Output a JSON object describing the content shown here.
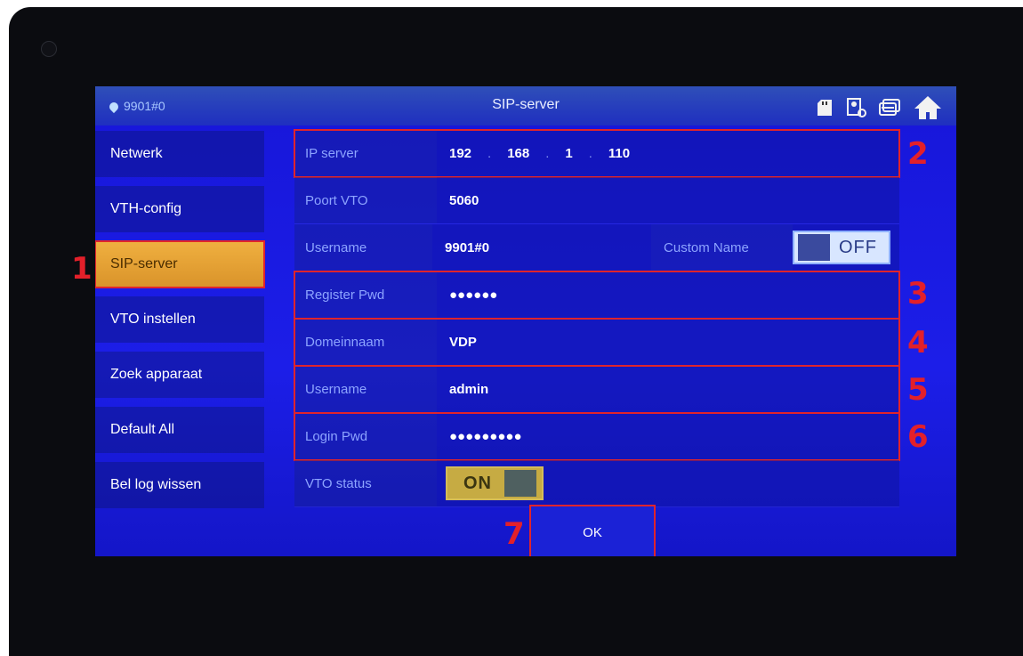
{
  "header": {
    "device_id": "9901#0",
    "title": "SIP-server",
    "icons": [
      "sd-card-icon",
      "device-settings-icon",
      "cards-icon",
      "home-icon"
    ]
  },
  "sidebar": {
    "items": [
      {
        "label": "Netwerk"
      },
      {
        "label": "VTH-config"
      },
      {
        "label": "SIP-server",
        "active": true
      },
      {
        "label": "VTO instellen"
      },
      {
        "label": "Zoek apparaat"
      },
      {
        "label": "Default All"
      },
      {
        "label": "Bel log wissen"
      }
    ]
  },
  "form": {
    "ip_server": {
      "label": "IP server",
      "octets": [
        "192",
        "168",
        "1",
        "110"
      ]
    },
    "port_vto": {
      "label": "Poort VTO",
      "value": "5060"
    },
    "username1": {
      "label": "Username",
      "value": "9901#0"
    },
    "custom_name": {
      "label": "Custom Name",
      "state": "OFF"
    },
    "register_pwd": {
      "label": "Register Pwd",
      "value": "●●●●●●"
    },
    "domain": {
      "label": "Domeinnaam",
      "value": "VDP"
    },
    "username2": {
      "label": "Username",
      "value": "admin"
    },
    "login_pwd": {
      "label": "Login Pwd",
      "value": "●●●●●●●●●"
    },
    "vto_status": {
      "label": "VTO status",
      "state": "ON"
    }
  },
  "ok_label": "OK",
  "annotations": [
    "1",
    "2",
    "3",
    "4",
    "5",
    "6",
    "7"
  ],
  "colors": {
    "accent": "#e0242c",
    "active_tab": "#e0a33a",
    "screen": "#1a1ce0"
  }
}
